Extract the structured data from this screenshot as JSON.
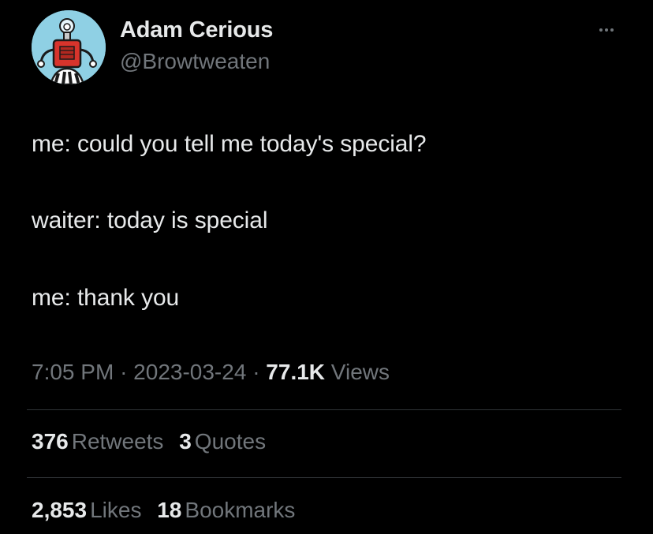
{
  "author": {
    "display_name": "Adam Cerious",
    "handle": "@Browtweaten",
    "avatar_icon": "robot-avatar-icon"
  },
  "menu_icon": "more-options-icon",
  "tweet": {
    "lines": [
      "me: could you tell me today's special?",
      "waiter: today is special",
      "me: thank you"
    ]
  },
  "meta": {
    "time": "7:05 PM",
    "separator": "·",
    "date": "2023-03-24",
    "views_count": "77.1K",
    "views_label": "Views"
  },
  "engagement": {
    "retweets_count": "376",
    "retweets_label": "Retweets",
    "quotes_count": "3",
    "quotes_label": "Quotes",
    "likes_count": "2,853",
    "likes_label": "Likes",
    "bookmarks_count": "18",
    "bookmarks_label": "Bookmarks"
  },
  "colors": {
    "background": "#000000",
    "primary_text": "#e7e9ea",
    "secondary_text": "#71767b",
    "divider": "#2f3336",
    "avatar_bg": "#8fd0e4",
    "robot_red": "#d8342c"
  }
}
